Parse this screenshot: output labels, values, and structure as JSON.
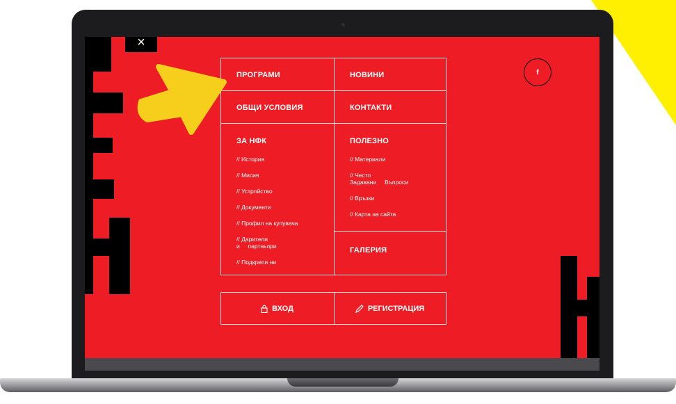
{
  "colors": {
    "screen_bg": "#ee1c24",
    "arrow": "#f5cf1c",
    "accent_yellow": "#ffef00"
  },
  "close_icon": "×",
  "social": {
    "facebook_label": "f"
  },
  "menu": {
    "programs": "ПРОГРАМИ",
    "news": "НОВИНИ",
    "terms": "ОБЩИ УСЛОВИЯ",
    "contacts": "КОНТАКТИ",
    "about": {
      "title": "ЗА НФК",
      "items": [
        "// История",
        "// Мисия",
        "// Устройство",
        "// Документи",
        "// Профил на купувача",
        "// Дарители и     партньори",
        "// Подкрепи ни"
      ]
    },
    "useful": {
      "title": "ПОЛЕЗНО",
      "items": [
        "// Материали",
        "// Често Задавани     Въпроси",
        "// Връзки",
        "// Карта на сайта"
      ]
    },
    "gallery": "ГАЛЕРИЯ"
  },
  "auth": {
    "login": "ВХОД",
    "register": "РЕГИСТРАЦИЯ"
  }
}
